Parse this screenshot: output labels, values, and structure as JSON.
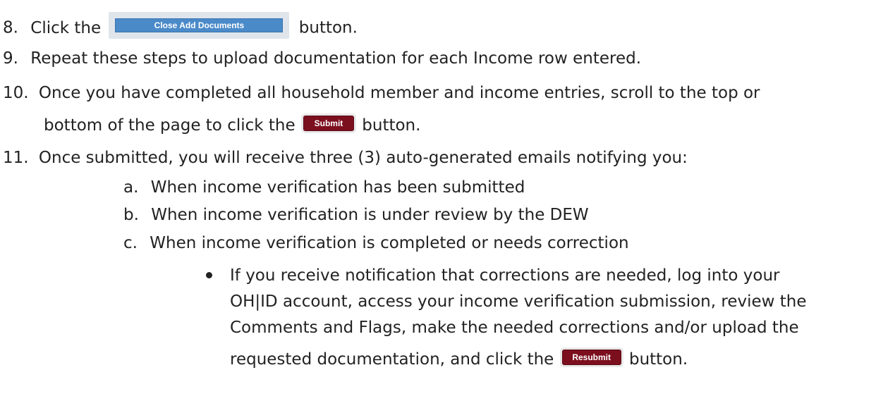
{
  "steps": [
    {
      "num": "8.",
      "pre": "Click the",
      "button": "Close Add Documents",
      "post": "button."
    },
    {
      "num": "9.",
      "text": "Repeat these steps to upload documentation for each Income row entered."
    },
    {
      "num": "10.",
      "text": "Once you have completed all household member and income entries, scroll to the top or",
      "cont_pre": "bottom of the page to click the",
      "button": "Submit",
      "cont_post": "button."
    },
    {
      "num": "11.",
      "text": "Once submitted, you will receive three (3) auto-generated emails notifying you:"
    }
  ],
  "sub_items": [
    {
      "letter": "a.",
      "text": "When income verification has been submitted"
    },
    {
      "letter": "b.",
      "text": "When income verification is under review by the DEW"
    },
    {
      "letter": "c.",
      "text": "When income verification is completed or needs correction"
    }
  ],
  "bullet": {
    "lines": [
      "If you receive notification that corrections are needed, log into your",
      "OH|ID account, access your income verification submission, review the",
      "Comments and Flags, make the needed corrections and/or upload the"
    ],
    "last_pre": "requested documentation, and click the",
    "button": "Resubmit",
    "last_post": "button."
  },
  "colors": {
    "text": "#222222",
    "blue_button": "#4a8ac9",
    "red_button": "#7c0f1e"
  }
}
